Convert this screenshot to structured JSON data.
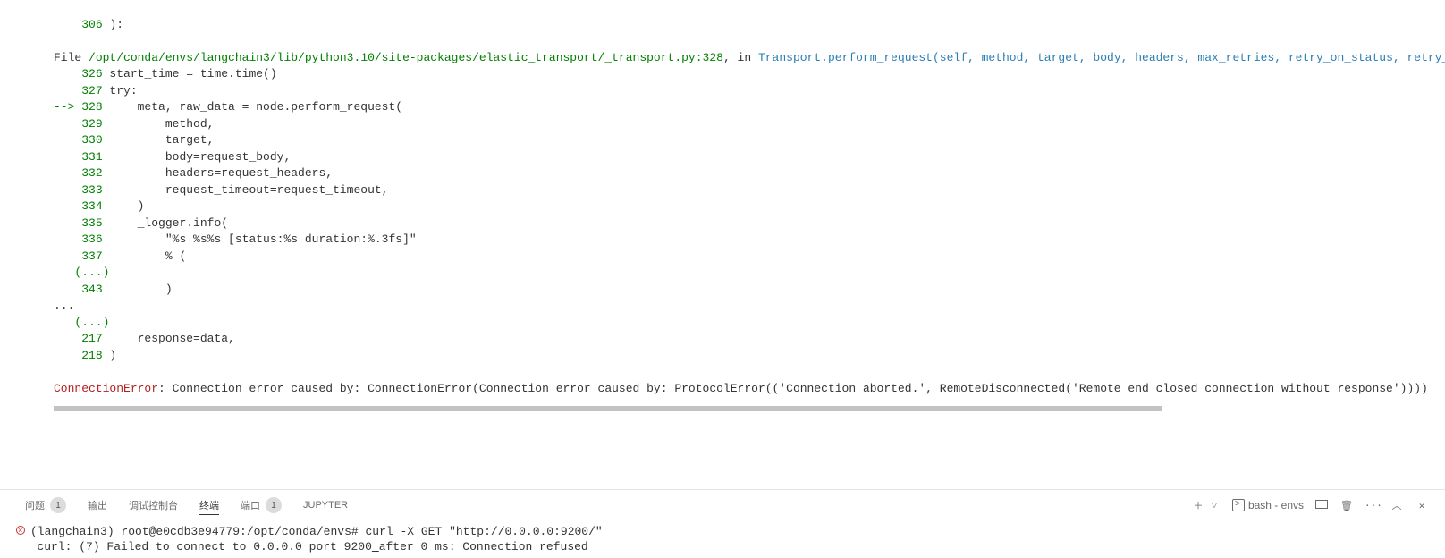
{
  "traceback": {
    "top_line": {
      "num": "306",
      "code": "):"
    },
    "file_prefix": "File ",
    "file_path": "/opt/conda/envs/langchain3/lib/python3.10/site-packages/elastic_transport/_transport.py:328",
    "file_sep": ", in ",
    "fn_sig": "Transport.perform_request(self, method, target, body, headers, max_retries, retry_on_status, retry_",
    "lines": [
      {
        "prefix": "    ",
        "num": "326",
        "code": " start_time = time.time()"
      },
      {
        "prefix": "    ",
        "num": "327",
        "code": " try:"
      },
      {
        "prefix": "--> ",
        "num": "328",
        "code": "     meta, raw_data = node.perform_request("
      },
      {
        "prefix": "    ",
        "num": "329",
        "code": "         method,"
      },
      {
        "prefix": "    ",
        "num": "330",
        "code": "         target,"
      },
      {
        "prefix": "    ",
        "num": "331",
        "code": "         body=request_body,"
      },
      {
        "prefix": "    ",
        "num": "332",
        "code": "         headers=request_headers,"
      },
      {
        "prefix": "    ",
        "num": "333",
        "code": "         request_timeout=request_timeout,"
      },
      {
        "prefix": "    ",
        "num": "334",
        "code": "     )"
      },
      {
        "prefix": "    ",
        "num": "335",
        "code": "     _logger.info("
      },
      {
        "prefix": "    ",
        "num": "336",
        "code": "         \"%s %s%s [status:%s duration:%.3fs]\""
      },
      {
        "prefix": "    ",
        "num": "337",
        "code": "         % ("
      }
    ],
    "ellipsis1": "   (...)",
    "line343": {
      "prefix": "    ",
      "num": "343",
      "code": "         )"
    },
    "dots": "...",
    "ellipsis2": "   (...)",
    "line217": {
      "prefix": "    ",
      "num": "217",
      "code": "     response=data,"
    },
    "line218": {
      "prefix": "    ",
      "num": "218",
      "code": " )"
    },
    "error_name": "ConnectionError",
    "error_msg": ": Connection error caused by: ConnectionError(Connection error caused by: ProtocolError(('Connection aborted.', RemoteDisconnected('Remote end closed connection without response'))))"
  },
  "panel": {
    "tabs": {
      "problems": "问题",
      "problems_count": "1",
      "output": "输出",
      "debug": "调试控制台",
      "terminal": "终端",
      "ports": "端口",
      "ports_count": "1",
      "jupyter": "JUPYTER"
    },
    "right": {
      "shell": "bash - envs"
    }
  },
  "terminal": {
    "prompt_env": "(langchain3) ",
    "prompt_host": "root@e0cdb3e94779:/opt/conda/envs# ",
    "cmd": "curl -X GET \"http://0.0.0.0:9200/\"",
    "out_before": "curl: (7) Failed to connect to 0.0.0.0 port 9200",
    "out_cursor": " ",
    "out_after": "after 0 ms: Connection refused"
  }
}
